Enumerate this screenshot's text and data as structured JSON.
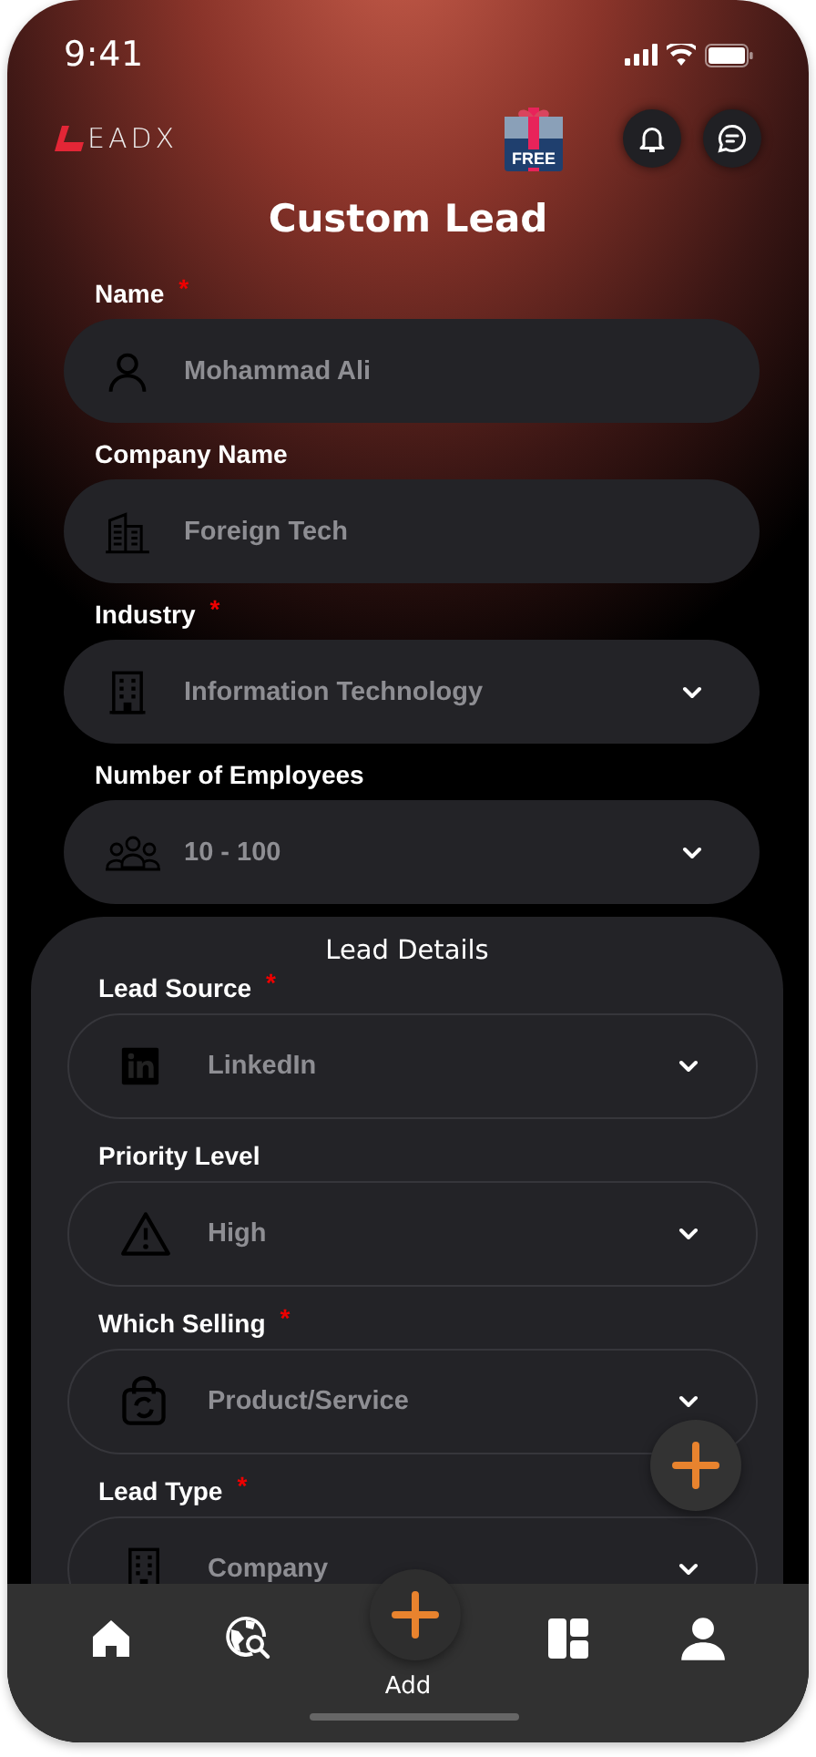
{
  "status_bar": {
    "time": "9:41"
  },
  "header": {
    "logo": "EADX",
    "promo_badge": "FREE"
  },
  "title": "Custom Lead",
  "fields": [
    {
      "label": "Name",
      "required_mark": "*",
      "value": "Mohammad Ali",
      "dropdown": false
    },
    {
      "label": "Company Name",
      "value": "Foreign Tech",
      "dropdown": false
    },
    {
      "label": "Industry",
      "required_mark": "*",
      "value": "Information Technology",
      "dropdown": true
    },
    {
      "label": "Number of Employees",
      "value": "10 - 100",
      "dropdown": true
    }
  ],
  "lead_details": {
    "title": "Lead Details",
    "fields": [
      {
        "label": "Lead Source",
        "required_mark": "*",
        "value": "LinkedIn",
        "dropdown": true
      },
      {
        "label": "Priority Level",
        "value": "High",
        "dropdown": true
      },
      {
        "label": "Which Selling",
        "required_mark": "*",
        "value": "Product/Service",
        "dropdown": true
      },
      {
        "label": "Lead Type",
        "required_mark": "*",
        "value": "Company",
        "dropdown": true
      }
    ]
  },
  "bottom_nav": {
    "add_label": "Add"
  }
}
